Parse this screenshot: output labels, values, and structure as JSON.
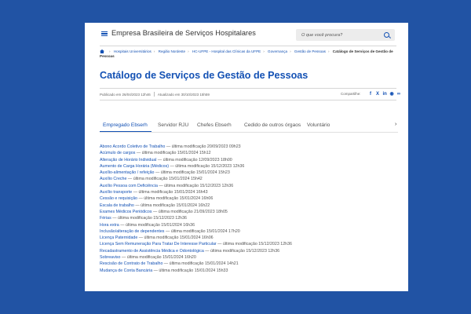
{
  "header": {
    "brand": "Empresa Brasileira de Serviços Hospitalares",
    "search_placeholder": "O que você procura?"
  },
  "breadcrumb": {
    "items": [
      "Hospitais Universitários",
      "Região Nordeste",
      "HC-UFPE - Hospital das Clínicas da UFPE",
      "Governança",
      "Gestão de Pessoas"
    ],
    "current": "Catálogo de Serviços de Gestão de Pessoas"
  },
  "page": {
    "title": "Catálogo de Serviços de Gestão de Pessoas",
    "published": "Publicado em 26/04/2023 12h46",
    "updated": "Atualizado em 30/10/2023 15h59",
    "share_label": "Compartilhe:"
  },
  "share_icons": [
    "facebook-icon",
    "x-icon",
    "linkedin-icon",
    "whatsapp-icon",
    "copy-link-icon"
  ],
  "tabs": [
    "Empregado Ebserh",
    "Servidor RJU",
    "Chefes Ebserh",
    "Cedido de outros órgaos",
    "Voluntário"
  ],
  "active_tab": 0,
  "services": [
    {
      "name": "Abono Acordo Coletivo de Trabalho",
      "meta": " — última modificação 20/09/2023 09h23"
    },
    {
      "name": "Acúmulo de cargos",
      "meta": " — última modificação 15/01/2024 15h12"
    },
    {
      "name": "Alteração de Horário Individual",
      "meta": " — última modificação 12/09/2023 18h00"
    },
    {
      "name": "Aumento de Carga Horária (Médicos)",
      "meta": " — última modificação 15/12/2023 12h36"
    },
    {
      "name": "Auxílio-alimentação / refeição",
      "meta": " — última modificação 15/01/2024 15h23"
    },
    {
      "name": "Auxílio Creche",
      "meta": " — última modificação 15/01/2024 15h42"
    },
    {
      "name": "Auxílio Pessoa com Deficiência",
      "meta": " — última modificação 15/12/2023 12h36"
    },
    {
      "name": "Auxílio transporte",
      "meta": " — última modificação 15/01/2024 16h43"
    },
    {
      "name": "Cessão e requisição",
      "meta": " — última modificação 15/01/2024 16h06"
    },
    {
      "name": "Escala de trabalho",
      "meta": " — última modificação 15/01/2024 16h22"
    },
    {
      "name": "Exames Médicos Periódicos",
      "meta": " — última modificação 21/09/2023 18h05"
    },
    {
      "name": "Férias",
      "meta": " — última modificação 15/12/2023 12h36"
    },
    {
      "name": "Hora extra",
      "meta": " — última modificação 15/01/2024 16h36"
    },
    {
      "name": "Inclusão/alteração de dependentes",
      "meta": " — última modificação 15/01/2024 17h20"
    },
    {
      "name": "Licença Paternidade",
      "meta": " — última modificação 15/01/2024 16h06"
    },
    {
      "name": "Licença Sem Remuneração Para Tratar De Interesse Particular",
      "meta": " — última modificação 15/12/2023 12h36"
    },
    {
      "name": "Recadastramento de Assistência Médica e Odontológica",
      "meta": " — última modificação 15/12/2023 12h36"
    },
    {
      "name": "Sobreaviso",
      "meta": " — última modificação 15/01/2024 16h20"
    },
    {
      "name": "Rescisão de Contrato de Trabalho",
      "meta": " — última modificação 15/01/2024 14h21"
    },
    {
      "name": "Mudança de Conta Bancária",
      "meta": " — última modificação 15/01/2024 15h33"
    }
  ]
}
